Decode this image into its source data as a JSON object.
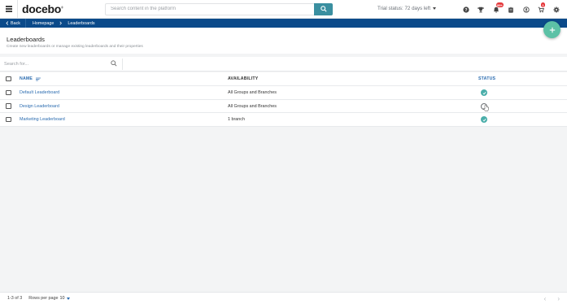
{
  "topbar": {
    "logo": "docebo",
    "search_placeholder": "Search content in the platform",
    "trial_status": "Trial status: 72 days left",
    "notifications_badge": "99+",
    "messages_badge": "1",
    "icons": [
      "help-icon",
      "trophy-icon",
      "bell-icon",
      "clipboard-icon",
      "user-sync-icon",
      "cart-icon",
      "gear-icon"
    ]
  },
  "breadcrumb": {
    "back_label": "Back",
    "items": [
      "Homepage",
      "Leaderboards"
    ]
  },
  "page": {
    "title": "Leaderboards",
    "subtitle": "Create new leaderboards or manage existing leaderboards and their properties"
  },
  "filter": {
    "placeholder": "Search for..."
  },
  "table": {
    "columns": {
      "name": "NAME",
      "availability": "AVAILABILITY",
      "status": "STATUS"
    },
    "rows": [
      {
        "name": "Default Leaderboard",
        "availability": "All Groups and Branches",
        "status": "active"
      },
      {
        "name": "Design Leaderboard",
        "availability": "All Groups and Branches",
        "status": "loading"
      },
      {
        "name": "Marketing Leaderboard",
        "availability": "1 branch",
        "status": "active"
      }
    ]
  },
  "footer": {
    "range": "1-3 of 3",
    "rows_per_page_label": "Rows per page",
    "rows_per_page_value": "10"
  },
  "colors": {
    "brand_blue": "#0b4a8a",
    "accent_green": "#5cc1a6",
    "search_teal": "#3a8fa0",
    "link_blue": "#2b6cb0"
  }
}
